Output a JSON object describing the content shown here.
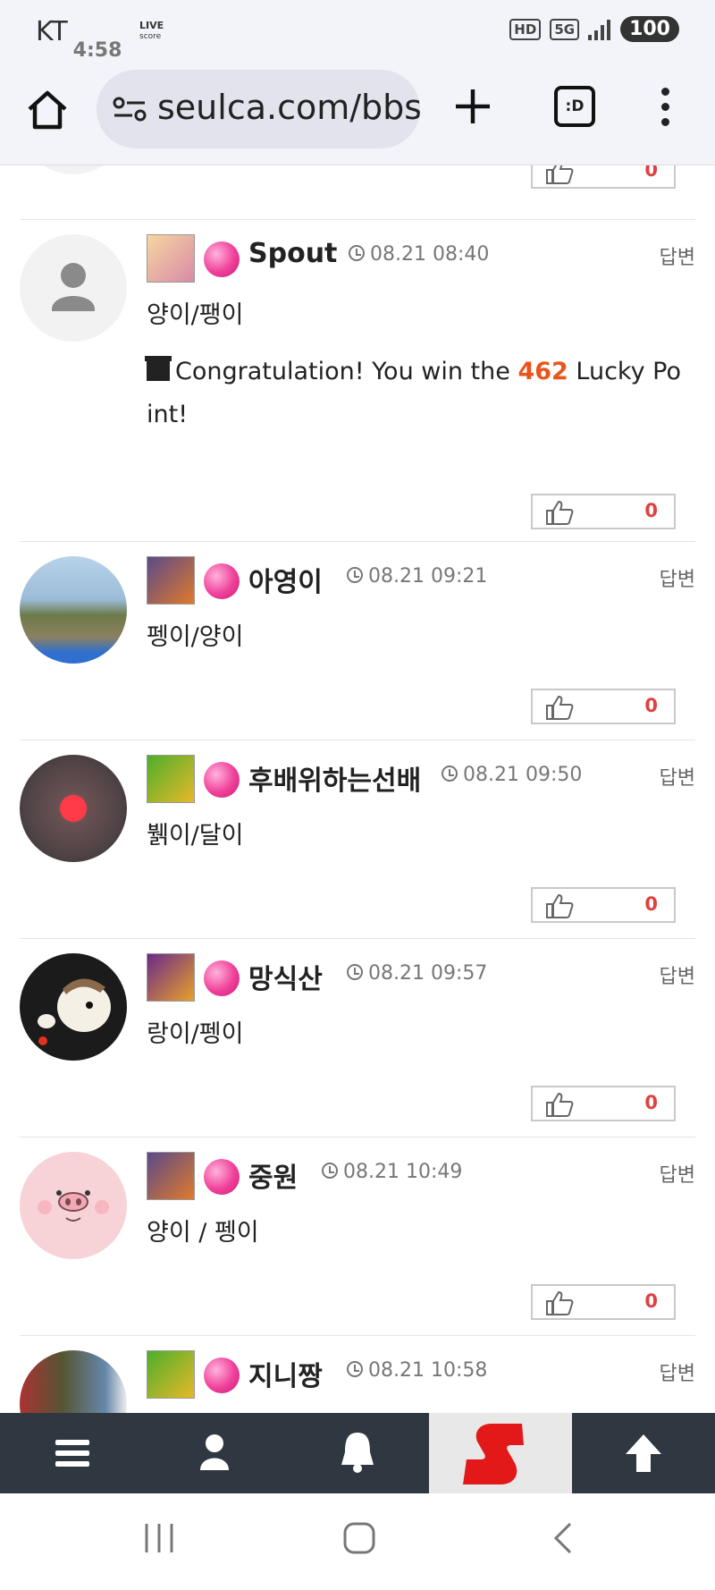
{
  "status_bar": {
    "carrier": "KT",
    "time": "4:58",
    "live_line1": "LIVE",
    "live_line2": "score",
    "hd": "HD",
    "network": "5G",
    "battery": "100"
  },
  "browser": {
    "url": "seulca.com/bbs",
    "tabs_label": ":D"
  },
  "comments": [
    {
      "nick": "",
      "time": "",
      "body": "",
      "likes": "0",
      "reply": ""
    },
    {
      "nick": "Spout",
      "time": "08.21 08:40",
      "body": "양이/팽이",
      "reply": "답변",
      "likes": "0",
      "lucky_before": "Congratulation! You win the ",
      "lucky_points": "462",
      "lucky_after": " Lucky Po int!"
    },
    {
      "nick": "아영이",
      "time": "08.21 09:21",
      "body": "펭이/양이",
      "reply": "답변",
      "likes": "0"
    },
    {
      "nick": "후배위하는선배",
      "time": "08.21 09:50",
      "body": "뷁이/달이",
      "reply": "답변",
      "likes": "0"
    },
    {
      "nick": "망식산",
      "time": "08.21 09:57",
      "body": "랑이/펭이",
      "reply": "답변",
      "likes": "0"
    },
    {
      "nick": "중원",
      "time": "08.21 10:49",
      "body": "양이 / 펭이",
      "reply": "답변",
      "likes": "0"
    },
    {
      "nick": "지니짱",
      "time": "08.21 10:58",
      "body": "",
      "reply": "답변",
      "likes": ""
    }
  ],
  "bottom_nav": [
    "menu-icon",
    "user-icon",
    "bell-icon",
    "site-logo",
    "arrow-up-icon"
  ],
  "system_nav": [
    "recent-apps-icon",
    "home-icon",
    "back-icon"
  ],
  "colors": {
    "like_count": "#e04040",
    "lucky_points": "#e8551c",
    "bottom_nav_bg": "#2f3740",
    "level_ball": "#f0409a"
  }
}
